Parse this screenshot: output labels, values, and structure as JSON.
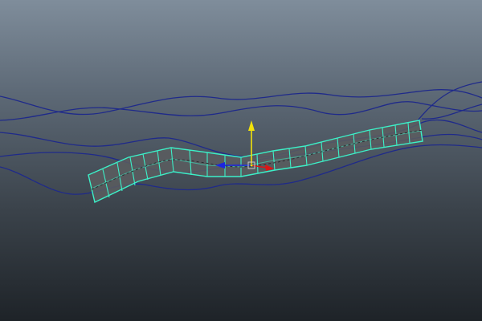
{
  "viewport": {
    "background_top": "#7f8d9b",
    "background_bottom": "#1e2328"
  },
  "colors": {
    "curve": "#1f2a8a",
    "wireframe": "#3cf0c8",
    "surface": "#5b5d5f",
    "axis_x": "#dd1515",
    "axis_y": "#f2e20a",
    "axis_z": "#1c26e0",
    "pivot": "#c9c9c9"
  },
  "icons": {
    "manipulator": "move-manipulator-icon",
    "pivot": "pivot-icon"
  }
}
